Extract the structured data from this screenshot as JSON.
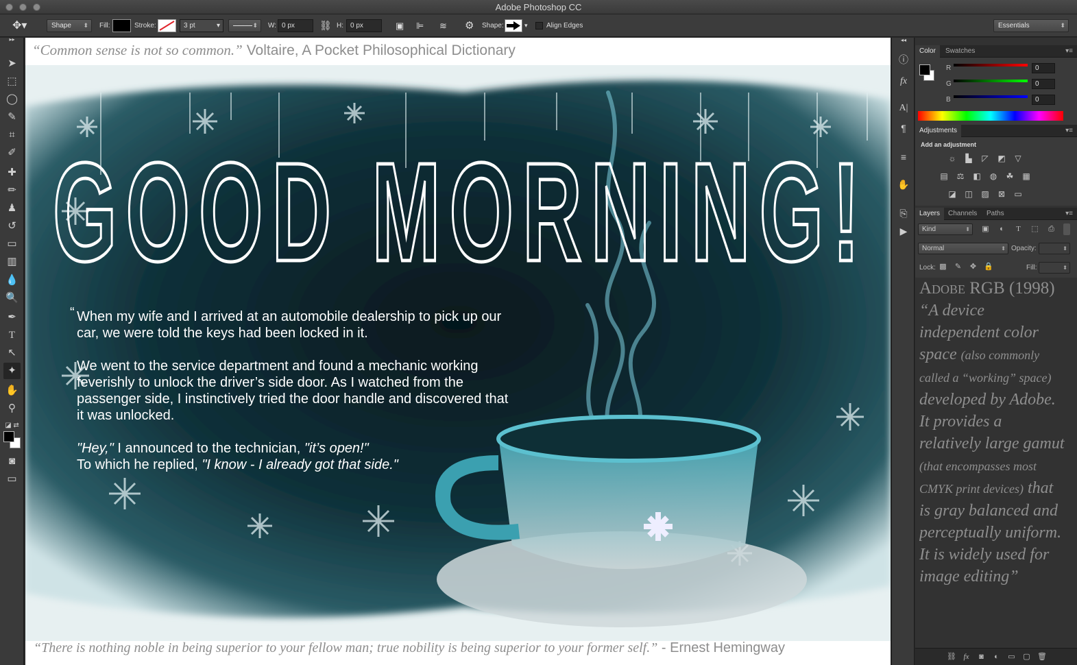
{
  "window": {
    "title": "Adobe Photoshop CC"
  },
  "options_bar": {
    "tool_mode": "Shape",
    "fill_label": "Fill:",
    "stroke_label": "Stroke:",
    "stroke_width": "3 pt",
    "width_label": "W:",
    "width_value": "0 px",
    "height_label": "H:",
    "height_value": "0 px",
    "shape_label": "Shape:",
    "align_edges_label": "Align Edges",
    "workspace": "Essentials"
  },
  "canvas": {
    "top_quote": "“Common sense is not so common.”",
    "top_quote_author": "Voltaire, A Pocket Philosophical Dictionary",
    "headline": "GOOD MORNING!",
    "joke": {
      "open_quote": "“",
      "p1": "When my wife and I arrived at an automobile dealership to pick up  our car, we were told the keys had been locked in it.",
      "p2": "We went to the service  department and found a mechanic working feverishly to unlock the driver’s side door.  As I watched from the passenger side, I instinctively tried the door handle and discovered that it was unlocked.",
      "p3a": "\"Hey,\"",
      "p3b": " I announced to the technician, ",
      "p3c": "\"it’s open!\"",
      "p4a": "To which he replied, ",
      "p4b": "\"I know - I already got that side.\""
    },
    "bottom_quote": "“There is nothing noble in being superior to your fellow man; true nobility is being superior to your former self.”",
    "bottom_quote_author": " - Ernest Hemingway"
  },
  "color_panel": {
    "tabs": [
      "Color",
      "Swatches"
    ],
    "r_label": "R",
    "r_value": "0",
    "g_label": "G",
    "g_value": "0",
    "b_label": "B",
    "b_value": "0"
  },
  "adjustments_panel": {
    "tab": "Adjustments",
    "heading": "Add an adjustment"
  },
  "layers_panel": {
    "tabs": [
      "Layers",
      "Channels",
      "Paths"
    ],
    "kind_filter": "Kind",
    "blend_mode": "Normal",
    "opacity_label": "Opacity:",
    "lock_label": "Lock:",
    "fill_label": "Fill:"
  },
  "info_panel": {
    "title": "Adobe RGB (1998)",
    "b1": "“A device independent color space ",
    "b2": "(also commonly called a “working” space)",
    "b3": " developed by Adobe. It provides a relatively large gamut ",
    "b4": "(that encompasses most CMYK print devices)",
    "b5": " that is gray balanced and perceptually uniform. It is widely used for image editing”"
  },
  "colors": {
    "accent": "#1f4f5a",
    "canvas_dark": "#0c2a31",
    "steam": "#7fd0e0"
  }
}
